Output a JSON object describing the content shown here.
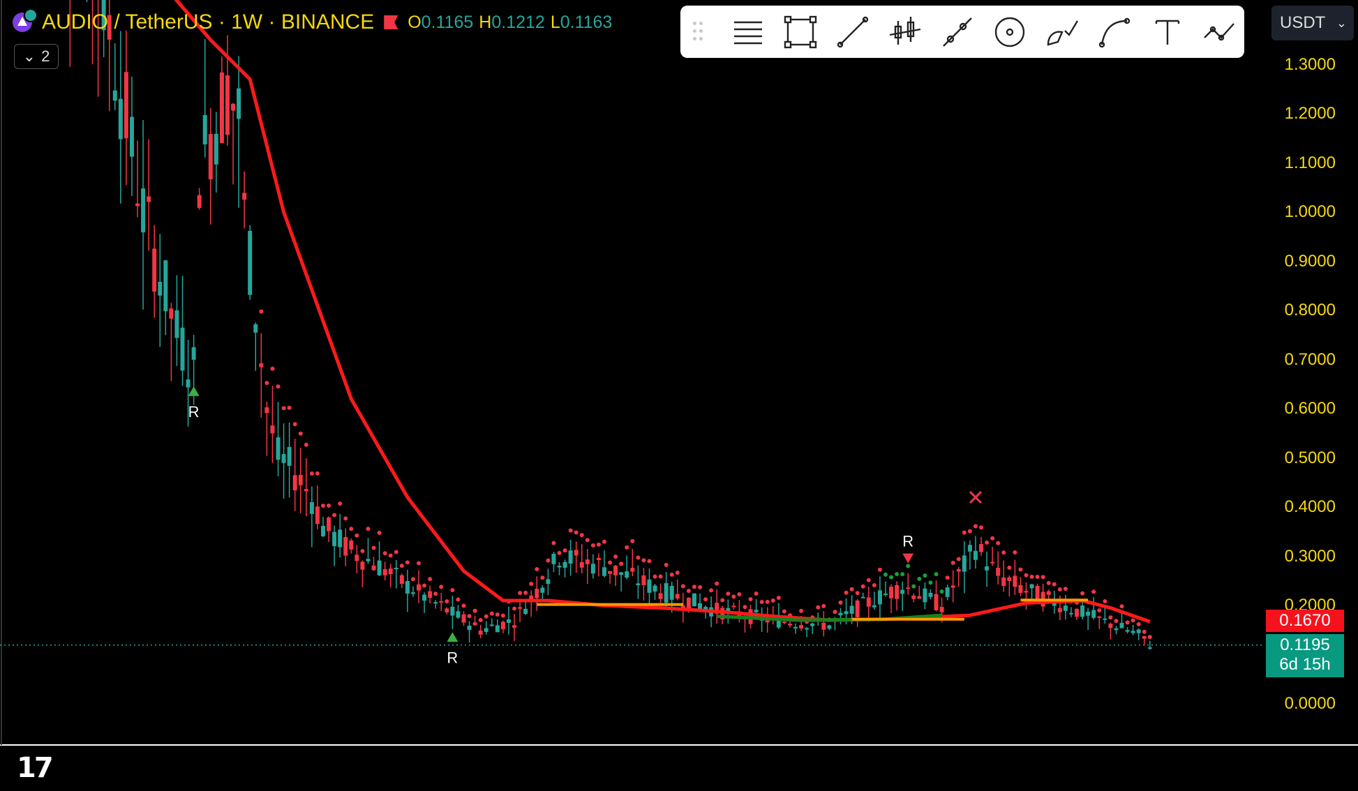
{
  "header": {
    "title": "AUDIO / TetherUS · 1W · BINANCE",
    "ohlc": [
      {
        "key": "O",
        "value": "0.1165"
      },
      {
        "key": "H",
        "value": "0.1212"
      },
      {
        "key": "L",
        "value": "0.1163"
      }
    ],
    "collapse_count": "2"
  },
  "currency": {
    "label": "USDT"
  },
  "toolbar_icons": [
    "horizontal-lines-icon",
    "rectangle-icon",
    "trend-line-icon",
    "candles-icon",
    "path-icon",
    "circle-target-icon",
    "brush-icon",
    "curve-icon",
    "text-icon",
    "polyline-icon"
  ],
  "colors": {
    "up": "#26a69a",
    "down": "#f23645",
    "ma_line": "#ff1a1a",
    "axis_text": "#f5d90a",
    "baseline": "#ff9800",
    "green_line": "#1b7f1b"
  },
  "price_tags": [
    {
      "value": "0.1670",
      "color": "#f5121d"
    },
    {
      "value": "0.1195",
      "sub": "6d 15h",
      "color": "#089981"
    }
  ],
  "chart_data": {
    "type": "candlestick",
    "y_ticks": [
      "1.3000",
      "1.2000",
      "1.1000",
      "1.0000",
      "0.9000",
      "0.8000",
      "0.7000",
      "0.6000",
      "0.5000",
      "0.4000",
      "0.3000",
      "0.2000",
      "0.0000"
    ],
    "ylim": [
      0.0,
      1.37
    ],
    "current_price": 0.1195,
    "markers": [
      {
        "label": "R",
        "type": "triangle-up",
        "index": 27,
        "price": 0.64
      },
      {
        "label": "R",
        "type": "triangle-up",
        "index": 73,
        "price": 0.14
      },
      {
        "label": "R",
        "type": "triangle-down",
        "index": 154,
        "price": 0.3
      },
      {
        "label": "",
        "type": "cross",
        "index": 166,
        "price": 0.42
      }
    ],
    "ma_line": [
      [
        0,
        1.75
      ],
      [
        30,
        1.35
      ],
      [
        37,
        1.27
      ],
      [
        43,
        1.0
      ],
      [
        55,
        0.62
      ],
      [
        65,
        0.42
      ],
      [
        75,
        0.27
      ],
      [
        82,
        0.21
      ],
      [
        90,
        0.21
      ],
      [
        100,
        0.2
      ],
      [
        110,
        0.195
      ],
      [
        120,
        0.188
      ],
      [
        130,
        0.178
      ],
      [
        140,
        0.17
      ],
      [
        150,
        0.172
      ],
      [
        165,
        0.18
      ],
      [
        175,
        0.205
      ],
      [
        185,
        0.21
      ],
      [
        190,
        0.195
      ],
      [
        197,
        0.167
      ]
    ],
    "baselines": [
      {
        "from": 88,
        "to": 114,
        "price": 0.202,
        "color": "#ff9800"
      },
      {
        "from": 144,
        "to": 164,
        "price": 0.172,
        "color": "#ff9800"
      },
      {
        "from": 174,
        "to": 186,
        "price": 0.211,
        "color": "#ff9800"
      }
    ]
  }
}
